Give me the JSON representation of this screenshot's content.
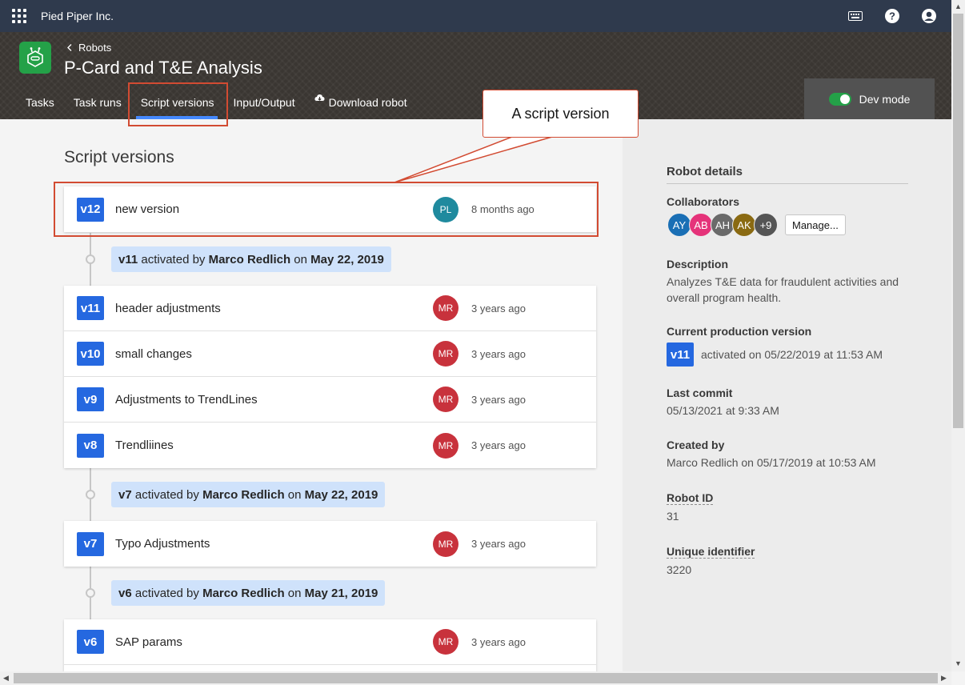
{
  "topbar": {
    "org_name": "Pied Piper Inc."
  },
  "header": {
    "breadcrumb": "Robots",
    "title": "P-Card and T&E Analysis",
    "tabs": [
      "Tasks",
      "Task runs",
      "Script versions",
      "Input/Output",
      "Download robot"
    ],
    "dev_mode_label": "Dev mode"
  },
  "main": {
    "section_title": "Script versions",
    "versions": [
      {
        "badge": "v12",
        "name": "new version",
        "initials": "PL",
        "avatar_color": "#1f8a9e",
        "time": "8 months ago"
      },
      {
        "badge": "v11",
        "name": "header adjustments",
        "initials": "MR",
        "avatar_color": "#c8323c",
        "time": "3 years ago"
      },
      {
        "badge": "v10",
        "name": "small changes",
        "initials": "MR",
        "avatar_color": "#c8323c",
        "time": "3 years ago"
      },
      {
        "badge": "v9",
        "name": "Adjustments to TrendLines",
        "initials": "MR",
        "avatar_color": "#c8323c",
        "time": "3 years ago"
      },
      {
        "badge": "v8",
        "name": "Trendliines",
        "initials": "MR",
        "avatar_color": "#c8323c",
        "time": "3 years ago"
      },
      {
        "badge": "v7",
        "name": "Typo Adjustments",
        "initials": "MR",
        "avatar_color": "#c8323c",
        "time": "3 years ago"
      },
      {
        "badge": "v6",
        "name": "SAP params",
        "initials": "MR",
        "avatar_color": "#c8323c",
        "time": "3 years ago"
      }
    ],
    "activations": [
      {
        "version": "v11",
        "mid1": " activated by ",
        "by": "Marco Redlich",
        "mid2": " on ",
        "date": "May 22, 2019"
      },
      {
        "version": "v7",
        "mid1": " activated by ",
        "by": "Marco Redlich",
        "mid2": " on ",
        "date": "May 22, 2019"
      },
      {
        "version": "v6",
        "mid1": " activated by ",
        "by": "Marco Redlich",
        "mid2": " on ",
        "date": "May 21, 2019"
      }
    ]
  },
  "annotation": {
    "callout_text": "A script version"
  },
  "sidebar": {
    "title": "Robot details",
    "collaborators_label": "Collaborators",
    "collaborators": [
      {
        "initials": "AY",
        "color": "#1a6fb5"
      },
      {
        "initials": "AB",
        "color": "#e5337a"
      },
      {
        "initials": "AH",
        "color": "#6a6a6a"
      },
      {
        "initials": "AK",
        "color": "#8a6a12"
      },
      {
        "initials": "+9",
        "color": "#555555"
      }
    ],
    "manage_label": "Manage...",
    "description_label": "Description",
    "description": "Analyzes T&E data for fraudulent activities and overall program health.",
    "current_prod_label": "Current production version",
    "current_prod_badge": "v11",
    "current_prod_text": "activated on 05/22/2019 at 11:53 AM",
    "last_commit_label": "Last commit",
    "last_commit": "05/13/2021 at 9:33 AM",
    "created_by_label": "Created by",
    "created_by": "Marco Redlich on 05/17/2019 at 10:53 AM",
    "robot_id_label": "Robot ID",
    "robot_id": "31",
    "unique_id_label": "Unique identifier",
    "unique_id": "3220"
  },
  "colors": {
    "accent": "#2568e0",
    "activation_bg": "#cfe2fb",
    "annotation": "#d24b32"
  }
}
